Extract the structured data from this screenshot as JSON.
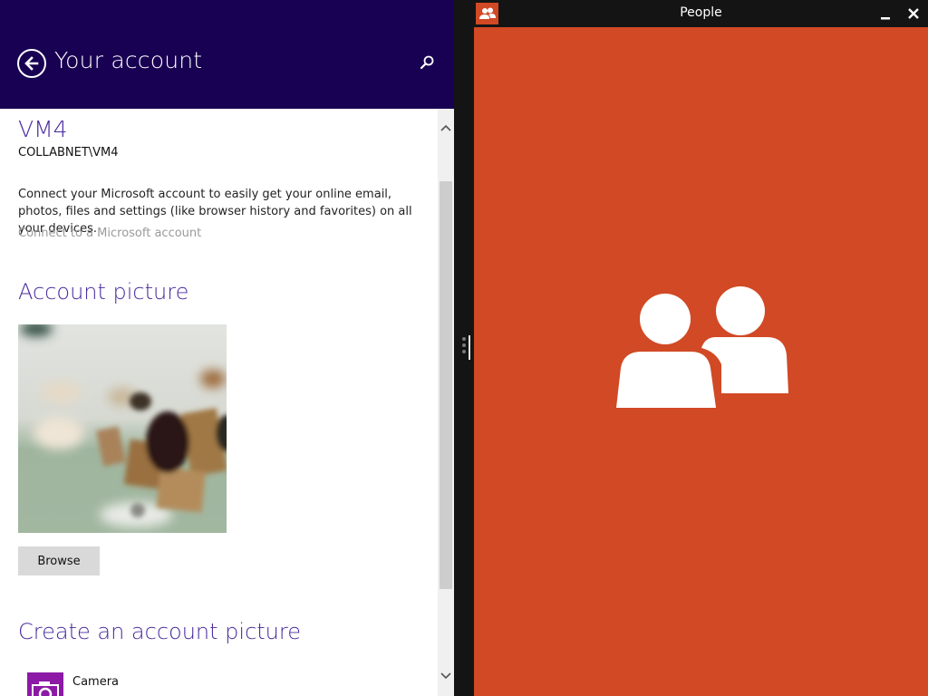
{
  "settings": {
    "header": {
      "title": "Your account",
      "back_icon": "back-arrow-icon",
      "search_icon": "search-icon"
    },
    "user": {
      "name": "VM4",
      "domain": "COLLABNET\\VM4"
    },
    "microsoft_account": {
      "description": "Connect your Microsoft account to easily get your online email, photos, files and settings (like browser history and favorites) on all your devices.",
      "link_label": "Connect to a Microsoft account"
    },
    "account_picture": {
      "heading": "Account picture",
      "browse_label": "Browse"
    },
    "create_picture": {
      "heading": "Create an account picture",
      "items": [
        {
          "label": "Camera",
          "icon": "camera-icon"
        }
      ]
    }
  },
  "people_app": {
    "title": "People",
    "app_icon": "people-icon",
    "window_controls": {
      "minimize_icon": "minimize-icon",
      "close_icon": "close-icon"
    },
    "splash_icon": "people-icon"
  },
  "colors": {
    "settings_header": "#180052",
    "accent_purple": "#4a2a9e",
    "people_brand": "#d14925",
    "camera_tile": "#8c1aa6",
    "browse_button": "#d9d9d9"
  }
}
